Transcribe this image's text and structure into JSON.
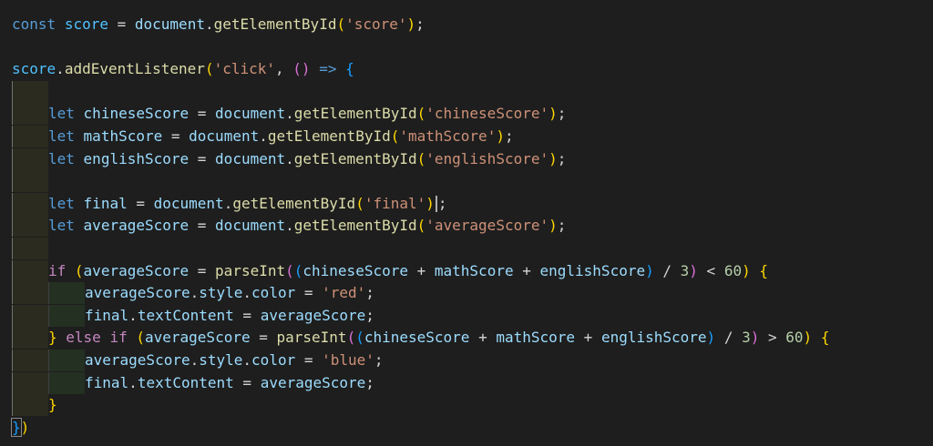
{
  "editor": {
    "language": "javascript",
    "theme_colors": {
      "background": "#1e1e1e",
      "keyword": "#569cd6",
      "control": "#c586c0",
      "variable": "#9cdcfe",
      "constant": "#4fc1ff",
      "function": "#dcdcaa",
      "string": "#ce9178",
      "number": "#b5cea8",
      "bracket1": "#ffd700",
      "bracket2": "#da70d6",
      "bracket3": "#179fff",
      "default": "#d4d4d4"
    },
    "lines": [
      {
        "indent": 0,
        "tokens": [
          [
            "const",
            "keyword"
          ],
          [
            " ",
            "default"
          ],
          [
            "score",
            "constant"
          ],
          [
            " = ",
            "default"
          ],
          [
            "document",
            "variable"
          ],
          [
            ".",
            "default"
          ],
          [
            "getElementById",
            "function"
          ],
          [
            "(",
            "bracket1"
          ],
          [
            "'score'",
            "string"
          ],
          [
            ")",
            "bracket1"
          ],
          [
            ";",
            "default"
          ]
        ]
      },
      {
        "indent": 0,
        "tokens": []
      },
      {
        "indent": 0,
        "tokens": [
          [
            "score",
            "constant"
          ],
          [
            ".",
            "default"
          ],
          [
            "addEventListener",
            "function"
          ],
          [
            "(",
            "bracket1"
          ],
          [
            "'click'",
            "string"
          ],
          [
            ", ",
            "default"
          ],
          [
            "()",
            "bracket2"
          ],
          [
            " ",
            "default"
          ],
          [
            "=>",
            "keyword"
          ],
          [
            " ",
            "default"
          ],
          [
            "{",
            "bracket3"
          ]
        ]
      },
      {
        "indent": 1,
        "tokens": []
      },
      {
        "indent": 1,
        "tokens": [
          [
            "let",
            "keyword"
          ],
          [
            " ",
            "default"
          ],
          [
            "chineseScore",
            "variable"
          ],
          [
            " = ",
            "default"
          ],
          [
            "document",
            "variable"
          ],
          [
            ".",
            "default"
          ],
          [
            "getElementById",
            "function"
          ],
          [
            "(",
            "bracket1"
          ],
          [
            "'chineseScore'",
            "string"
          ],
          [
            ")",
            "bracket1"
          ],
          [
            ";",
            "default"
          ]
        ]
      },
      {
        "indent": 1,
        "tokens": [
          [
            "let",
            "keyword"
          ],
          [
            " ",
            "default"
          ],
          [
            "mathScore",
            "variable"
          ],
          [
            " = ",
            "default"
          ],
          [
            "document",
            "variable"
          ],
          [
            ".",
            "default"
          ],
          [
            "getElementById",
            "function"
          ],
          [
            "(",
            "bracket1"
          ],
          [
            "'mathScore'",
            "string"
          ],
          [
            ")",
            "bracket1"
          ],
          [
            ";",
            "default"
          ]
        ]
      },
      {
        "indent": 1,
        "tokens": [
          [
            "let",
            "keyword"
          ],
          [
            " ",
            "default"
          ],
          [
            "englishScore",
            "variable"
          ],
          [
            " = ",
            "default"
          ],
          [
            "document",
            "variable"
          ],
          [
            ".",
            "default"
          ],
          [
            "getElementById",
            "function"
          ],
          [
            "(",
            "bracket1"
          ],
          [
            "'englishScore'",
            "string"
          ],
          [
            ")",
            "bracket1"
          ],
          [
            ";",
            "default"
          ]
        ]
      },
      {
        "indent": 1,
        "tokens": []
      },
      {
        "indent": 1,
        "tokens": [
          [
            "let",
            "keyword"
          ],
          [
            " ",
            "default"
          ],
          [
            "final",
            "variable"
          ],
          [
            " = ",
            "default"
          ],
          [
            "document",
            "variable"
          ],
          [
            ".",
            "default"
          ],
          [
            "getElementById",
            "function"
          ],
          [
            "(",
            "bracket1"
          ],
          [
            "'final'",
            "string"
          ],
          [
            ")",
            "bracket1"
          ],
          [
            ";",
            "default"
          ]
        ],
        "cursor": true
      },
      {
        "indent": 1,
        "tokens": [
          [
            "let",
            "keyword"
          ],
          [
            " ",
            "default"
          ],
          [
            "averageScore",
            "variable"
          ],
          [
            " = ",
            "default"
          ],
          [
            "document",
            "variable"
          ],
          [
            ".",
            "default"
          ],
          [
            "getElementById",
            "function"
          ],
          [
            "(",
            "bracket1"
          ],
          [
            "'averageScore'",
            "string"
          ],
          [
            ")",
            "bracket1"
          ],
          [
            ";",
            "default"
          ]
        ]
      },
      {
        "indent": 1,
        "tokens": []
      },
      {
        "indent": 1,
        "tokens": [
          [
            "if",
            "control"
          ],
          [
            " ",
            "default"
          ],
          [
            "(",
            "bracket1"
          ],
          [
            "averageScore",
            "variable"
          ],
          [
            " = ",
            "default"
          ],
          [
            "parseInt",
            "function"
          ],
          [
            "(",
            "bracket2"
          ],
          [
            "(",
            "bracket3"
          ],
          [
            "chineseScore",
            "variable"
          ],
          [
            " + ",
            "default"
          ],
          [
            "mathScore",
            "variable"
          ],
          [
            " + ",
            "default"
          ],
          [
            "englishScore",
            "variable"
          ],
          [
            ")",
            "bracket3"
          ],
          [
            " / ",
            "default"
          ],
          [
            "3",
            "number"
          ],
          [
            ")",
            "bracket2"
          ],
          [
            " < ",
            "default"
          ],
          [
            "60",
            "number"
          ],
          [
            ")",
            "bracket1"
          ],
          [
            " ",
            "default"
          ],
          [
            "{",
            "bracket1"
          ]
        ]
      },
      {
        "indent": 2,
        "tokens": [
          [
            "averageScore",
            "variable"
          ],
          [
            ".",
            "default"
          ],
          [
            "style",
            "variable"
          ],
          [
            ".",
            "default"
          ],
          [
            "color",
            "variable"
          ],
          [
            " = ",
            "default"
          ],
          [
            "'red'",
            "string"
          ],
          [
            ";",
            "default"
          ]
        ]
      },
      {
        "indent": 2,
        "tokens": [
          [
            "final",
            "variable"
          ],
          [
            ".",
            "default"
          ],
          [
            "textContent",
            "variable"
          ],
          [
            " = ",
            "default"
          ],
          [
            "averageScore",
            "variable"
          ],
          [
            ";",
            "default"
          ]
        ]
      },
      {
        "indent": 1,
        "tokens": [
          [
            "}",
            "bracket1"
          ],
          [
            " ",
            "default"
          ],
          [
            "else",
            "control"
          ],
          [
            " ",
            "default"
          ],
          [
            "if",
            "control"
          ],
          [
            " ",
            "default"
          ],
          [
            "(",
            "bracket1"
          ],
          [
            "averageScore",
            "variable"
          ],
          [
            " = ",
            "default"
          ],
          [
            "parseInt",
            "function"
          ],
          [
            "(",
            "bracket2"
          ],
          [
            "(",
            "bracket3"
          ],
          [
            "chineseScore",
            "variable"
          ],
          [
            " + ",
            "default"
          ],
          [
            "mathScore",
            "variable"
          ],
          [
            " + ",
            "default"
          ],
          [
            "englishScore",
            "variable"
          ],
          [
            ")",
            "bracket3"
          ],
          [
            " / ",
            "default"
          ],
          [
            "3",
            "number"
          ],
          [
            ")",
            "bracket2"
          ],
          [
            " > ",
            "default"
          ],
          [
            "60",
            "number"
          ],
          [
            ")",
            "bracket1"
          ],
          [
            " ",
            "default"
          ],
          [
            "{",
            "bracket1"
          ]
        ]
      },
      {
        "indent": 2,
        "tokens": [
          [
            "averageScore",
            "variable"
          ],
          [
            ".",
            "default"
          ],
          [
            "style",
            "variable"
          ],
          [
            ".",
            "default"
          ],
          [
            "color",
            "variable"
          ],
          [
            " = ",
            "default"
          ],
          [
            "'blue'",
            "string"
          ],
          [
            ";",
            "default"
          ]
        ]
      },
      {
        "indent": 2,
        "tokens": [
          [
            "final",
            "variable"
          ],
          [
            ".",
            "default"
          ],
          [
            "textContent",
            "variable"
          ],
          [
            " = ",
            "default"
          ],
          [
            "averageScore",
            "variable"
          ],
          [
            ";",
            "default"
          ]
        ]
      },
      {
        "indent": 1,
        "tokens": [
          [
            "}",
            "bracket1"
          ]
        ]
      },
      {
        "indent": 0,
        "tokens": [
          [
            "}",
            "bracket3"
          ],
          [
            ")",
            "bracket1"
          ]
        ],
        "bracket_match": true
      }
    ]
  }
}
